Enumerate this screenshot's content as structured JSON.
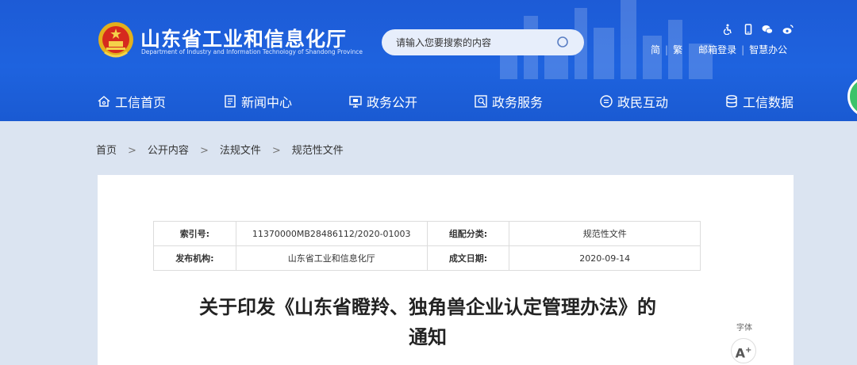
{
  "header": {
    "title_cn": "山东省工业和信息化厅",
    "title_en": "Department of Industry and Information Technology of Shandong Province",
    "emblem_icon": "national-emblem-icon",
    "search": {
      "placeholder": "请输入您要搜索的内容",
      "button_icon": "search-icon"
    },
    "util_icons": [
      "accessibility-icon",
      "mobile-icon",
      "wechat-icon",
      "weibo-icon"
    ],
    "util_links": {
      "simplified": "简",
      "traditional": "繁",
      "mail_login": "邮箱登录",
      "smart_office": "智慧办公"
    },
    "separator": "|",
    "colors": {
      "primary_blue": "#1e63df",
      "side_tab_green": "#3cc36a"
    }
  },
  "nav": {
    "items": [
      {
        "label": "工信首页",
        "icon": "home-icon"
      },
      {
        "label": "新闻中心",
        "icon": "news-icon"
      },
      {
        "label": "政务公开",
        "icon": "monitor-icon"
      },
      {
        "label": "政务服务",
        "icon": "service-icon"
      },
      {
        "label": "政民互动",
        "icon": "chat-icon"
      },
      {
        "label": "工信数据",
        "icon": "database-icon"
      }
    ]
  },
  "breadcrumb": {
    "items": [
      "首页",
      "公开内容",
      "法规文件",
      "规范性文件"
    ],
    "arrow": ">"
  },
  "meta_table": {
    "rows": [
      {
        "k1": "索引号:",
        "v1": "11370000MB28486112/2020-01003",
        "k2": "组配分类:",
        "v2": "规范性文件"
      },
      {
        "k1": "发布机构:",
        "v1": "山东省工业和信息化厅",
        "k2": "成文日期:",
        "v2": "2020-09-14"
      }
    ]
  },
  "document": {
    "title_line1": "关于印发《山东省瞪羚、独角兽企业认定管理办法》的",
    "title_line2": "通知"
  },
  "font_tool": {
    "label": "字体",
    "increase": "A",
    "plus": "+"
  }
}
